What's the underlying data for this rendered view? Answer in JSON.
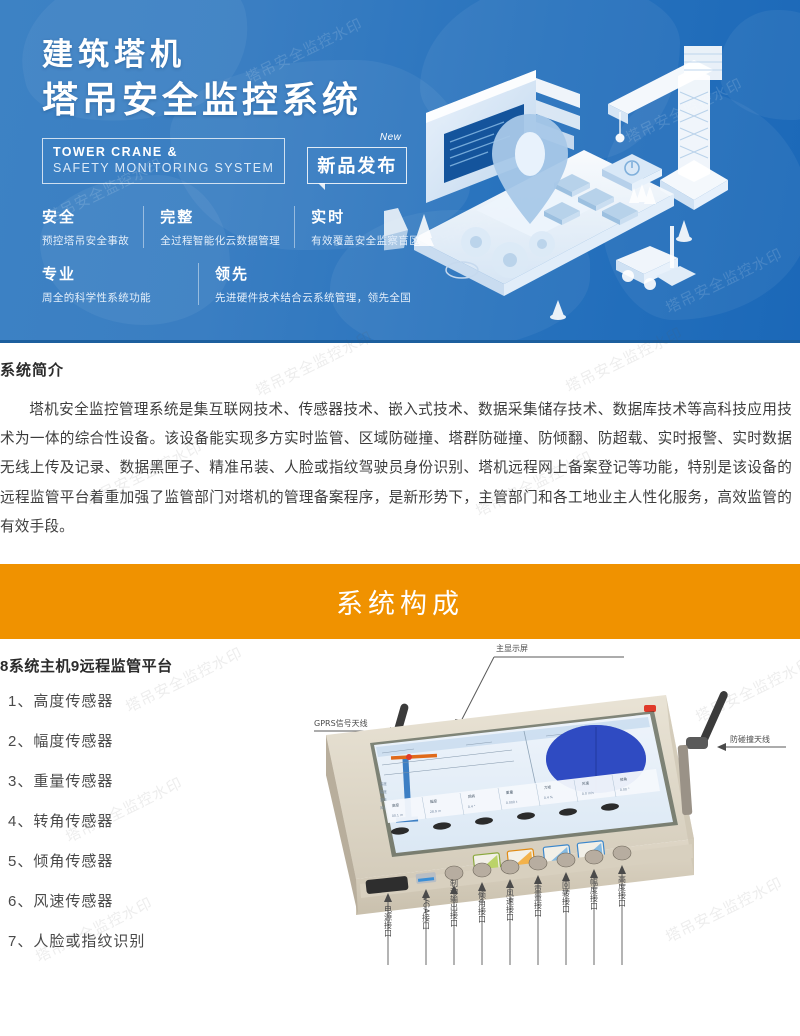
{
  "banner": {
    "title_line1": "建筑塔机",
    "title_line2": "塔吊安全监控系统",
    "english_line1": "TOWER CRANE &",
    "english_line2": "SAFETY MONITORING SYSTEM",
    "badge_new": "New",
    "badge_label": "新品发布",
    "features": [
      {
        "heading": "安全",
        "desc": "预控塔吊安全事故"
      },
      {
        "heading": "完整",
        "desc": "全过程智能化云数据管理"
      },
      {
        "heading": "实时",
        "desc": "有效覆盖安全监察盲区"
      },
      {
        "heading": "专业",
        "desc": "周全的科学性系统功能"
      },
      {
        "heading": "领先",
        "desc": "先进硬件技术结合云系统管理，领先全国"
      }
    ],
    "colors": {
      "blue_left": "#3d82c4",
      "blue_right": "#1b68b8",
      "border": "#1c5f9e"
    }
  },
  "intro": {
    "heading": "系统简介",
    "body": "塔机安全监控管理系统是集互联网技术、传感器技术、嵌入式技术、数据采集储存技术、数据库技术等高科技应用技术为一体的综合性设备。该设备能实现多方实时监管、区域防碰撞、塔群防碰撞、防倾翻、防超载、实时报警、实时数据无线上传及记录、数据黑匣子、精准吊装、人脸或指纹驾驶员身份识别、塔机远程网上备案登记等功能，特别是该设备的远程监管平台着重加强了监管部门对塔机的管理备案程序，是新形势下，主管部门和各工地业主人性化服务，高效监管的有效手段。"
  },
  "section_bar": {
    "label": "系统构成",
    "color": "#f09200"
  },
  "composition": {
    "heading": "8系统主机9远程监管平台",
    "items": [
      "1、高度传感器",
      "2、幅度传感器",
      "3、重量传感器",
      "4、转角传感器",
      "5、倾角传感器",
      "6、风速传感器",
      "7、人脸或指纹识别"
    ]
  },
  "device_diagram": {
    "callouts": {
      "top": "主显示屏",
      "left": "GPRS信号天线",
      "right": "防碰撞天线"
    },
    "port_labels": [
      "电源接口",
      "VGA接口",
      "制动输出接口",
      "倾角接口",
      "风速接口",
      "重量接口",
      "回转接口",
      "幅度接口",
      "高度接口"
    ],
    "screen_readouts": [
      "高度",
      "幅度",
      "回转",
      "重量",
      "力矩",
      "风速",
      "倾角"
    ]
  },
  "watermark": {
    "text": "塔吊安全监控水印"
  }
}
